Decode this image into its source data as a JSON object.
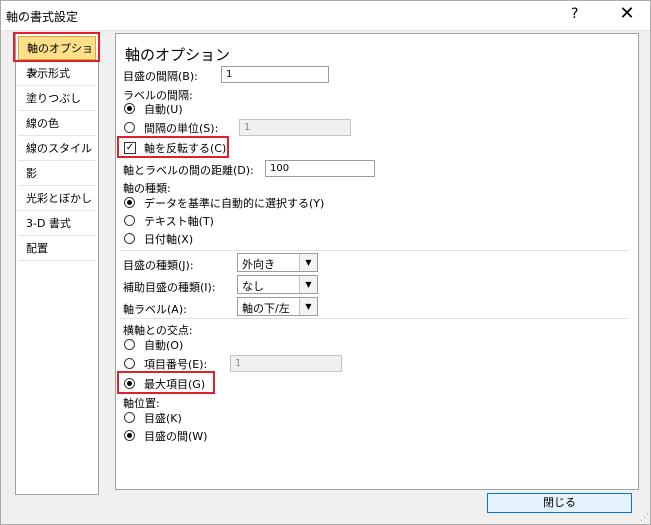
{
  "window": {
    "title": "軸の書式設定",
    "help": "?",
    "close": "✕"
  },
  "nav": {
    "items": [
      {
        "label": "軸のオプション"
      },
      {
        "label": "表示形式"
      },
      {
        "label": "塗りつぶし"
      },
      {
        "label": "線の色"
      },
      {
        "label": "線のスタイル"
      },
      {
        "label": "影"
      },
      {
        "label": "光彩とぼかし"
      },
      {
        "label": "3-D 書式"
      },
      {
        "label": "配置"
      }
    ],
    "selected_index": 0
  },
  "panel": {
    "title": "軸のオプション",
    "tick_interval": {
      "label": "目盛の間隔(B):",
      "value": "1"
    },
    "label_interval": {
      "label": "ラベルの間隔:",
      "auto": "自動(U)",
      "unit": "間隔の単位(S):",
      "unit_value": "1",
      "selected": "auto"
    },
    "reverse_order": {
      "label": "軸を反転する(C)",
      "checked": true,
      "mark": "✓"
    },
    "label_distance": {
      "label": "軸とラベルの間の距離(D):",
      "value": "100"
    },
    "axis_type": {
      "label": "軸の種類:",
      "options": [
        "データを基準に自動的に選択する(Y)",
        "テキスト軸(T)",
        "日付軸(X)"
      ],
      "selected_index": 0
    },
    "major_tick": {
      "label": "目盛の種類(J):",
      "value": "外向き"
    },
    "minor_tick": {
      "label": "補助目盛の種類(I):",
      "value": "なし"
    },
    "axis_labels": {
      "label": "軸ラベル(A):",
      "value": "軸の下/左"
    },
    "crosses": {
      "label": "横軸との交点:",
      "auto": "自動(O)",
      "category_number": "項目番号(E):",
      "category_value": "1",
      "max_category": "最大項目(G)",
      "selected": "max_category"
    },
    "axis_position": {
      "label": "軸位置:",
      "on_tick": "目盛(K)",
      "between_tick": "目盛の間(W)",
      "selected": "between_tick"
    }
  },
  "footer": {
    "close_label": "閉じる"
  }
}
